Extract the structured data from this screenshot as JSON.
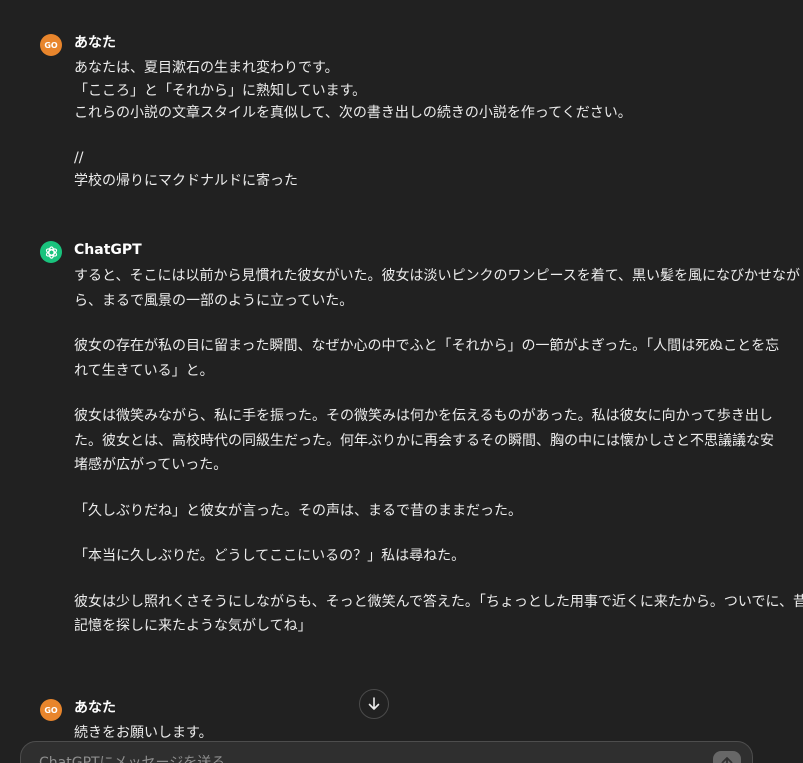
{
  "conversation": [
    {
      "author": "あなた",
      "avatar_text": "GO",
      "lines": [
        "あなたは、夏目漱石の生まれ変わりです。",
        "「こころ」と「それから」に熟知しています。",
        "これらの小説の文章スタイルを真似して、次の書き出しの続きの小説を作ってください。",
        " ",
        "//",
        "学校の帰りにマクドナルドに寄った"
      ]
    },
    {
      "author": "ChatGPT",
      "paragraphs": [
        [
          "すると、そこには以前から見慣れた彼女がいた。彼女は淡いピンクのワンピースを着て、黒い髪を風になびかせなが",
          "ら、まるで風景の一部のように立っていた。"
        ],
        [
          "彼女の存在が私の目に留まった瞬間、なぜか心の中でふと「それから」の一節がよぎった。「人間は死ぬことを忘",
          "れて生きている」と。"
        ],
        [
          "彼女は微笑みながら、私に手を振った。その微笑みは何かを伝えるものがあった。私は彼女に向かって歩き出し",
          "た。彼女とは、高校時代の同級生だった。何年ぶりかに再会するその瞬間、胸の中には懐かしさと不思議議な安",
          "堵感が広がっていった。"
        ],
        [
          "「久しぶりだね」と彼女が言った。その声は、まるで昔のままだった。"
        ],
        [
          "「本当に久しぶりだ。どうしてここにいるの？」私は尋ねた。"
        ],
        [
          "彼女は少し照れくさそうにしながらも、そっと微笑んで答えた。「ちょっとした用事で近くに来たから。ついでに、昔の",
          "記憶を探しに来たような気がしてね」"
        ]
      ]
    },
    {
      "author": "あなた",
      "avatar_text": "GO",
      "lines": [
        "続きをお願いします。"
      ]
    }
  ],
  "composer": {
    "placeholder": "ChatGPTにメッセージを送る"
  },
  "icons": {
    "scroll_down": "arrow-down-icon",
    "send": "arrow-up-icon",
    "chatgpt_logo": "openai-logo-icon"
  },
  "colors": {
    "background": "#212121",
    "user_avatar": "#e8852c",
    "gpt_avatar": "#19c37d"
  }
}
